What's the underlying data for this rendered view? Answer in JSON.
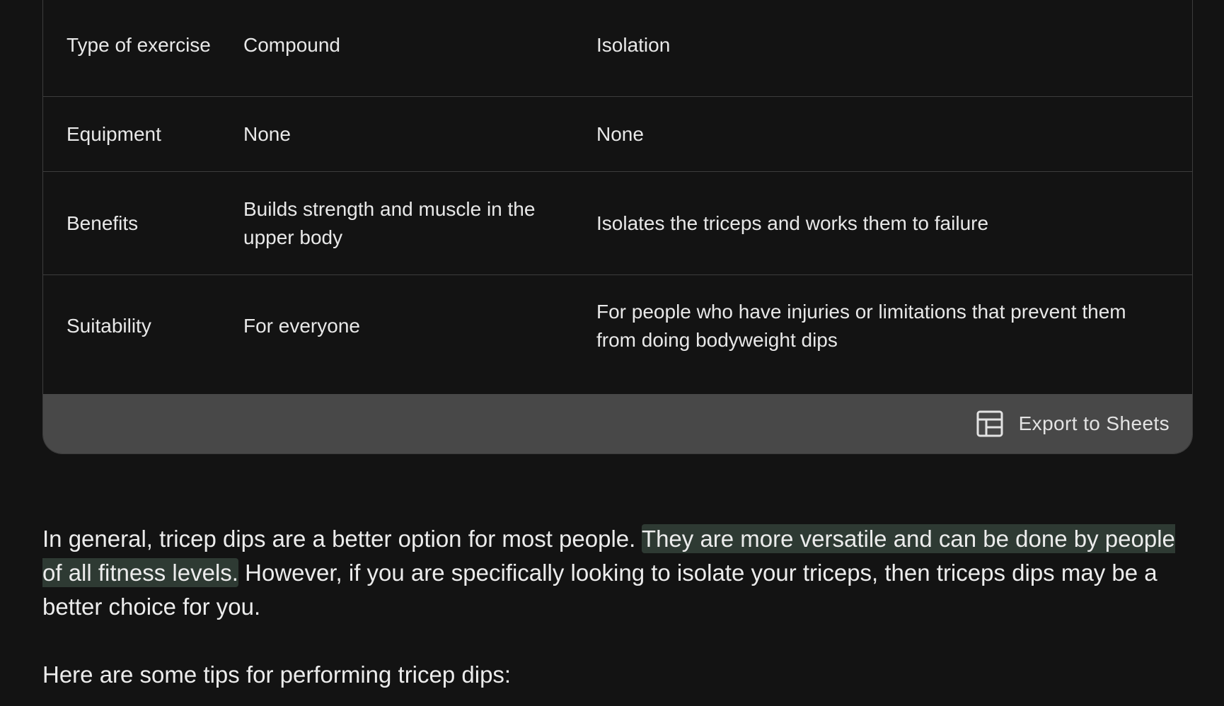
{
  "table": {
    "rows": [
      {
        "label": "Type of exercise",
        "col1": "Compound",
        "col2": "Isolation"
      },
      {
        "label": "Equipment",
        "col1": "None",
        "col2": "None"
      },
      {
        "label": "Benefits",
        "col1": "Builds strength and muscle in the upper body",
        "col2": "Isolates the triceps and works them to failure"
      },
      {
        "label": "Suitability",
        "col1": "For everyone",
        "col2": "For people who have injuries or limitations that prevent them from doing bodyweight dips"
      }
    ],
    "export_label": "Export to Sheets",
    "export_icon": "table-icon"
  },
  "response": {
    "p1_start": "In general, tricep dips are a better option for most people. ",
    "p1_highlight": "They are more versatile and can be done by people of all fitness levels.",
    "p1_end": " However, if you are specifically looking to isolate your triceps, then triceps dips may be a better choice for you.",
    "p2": "Here are some tips for performing tricep dips:"
  },
  "colors": {
    "background": "#131313",
    "export_bar": "#484848",
    "highlight": "#2e3a33"
  }
}
